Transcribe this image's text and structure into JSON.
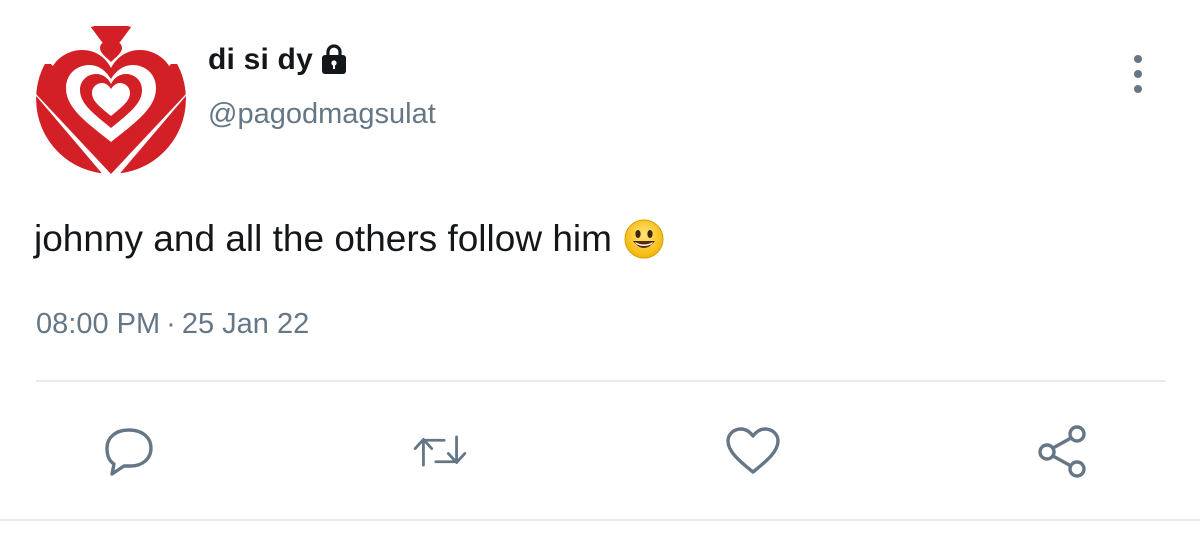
{
  "user": {
    "display_name": "di si dy",
    "handle": "@pagodmagsulat"
  },
  "tweet": {
    "text": "johnny and all the others follow him",
    "emoji": "smiling-face-icon",
    "time": "08:00 PM",
    "separator": "·",
    "date": "25 Jan 22"
  },
  "icons": {
    "lock": "lock-icon",
    "more": "more-vertical-icon",
    "reply": "reply-icon",
    "retweet": "retweet-icon",
    "like": "heart-icon",
    "share": "share-icon"
  },
  "colors": {
    "text": "#14171a",
    "secondary": "#657786",
    "divider": "#e6ecf0",
    "avatar_red": "#d32027"
  }
}
